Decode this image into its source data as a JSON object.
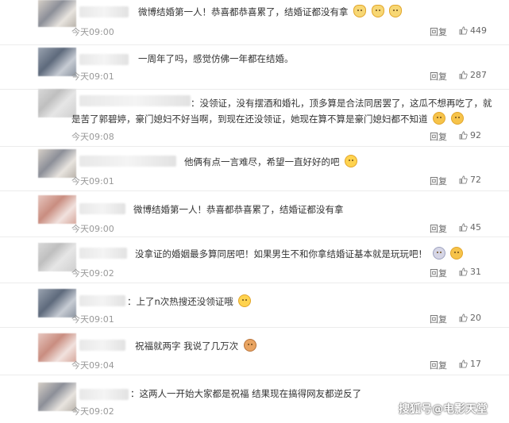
{
  "comments": [
    {
      "text": "微博结婚第一人！恭喜都恭喜累了，结婚证都没有拿",
      "time": "今天09:00",
      "reply": "回复",
      "likes": "449",
      "emojis": [
        "cat-icon",
        "cat-icon",
        "cat-icon"
      ]
    },
    {
      "text": "一周年了吗，感觉仿佛一年都在结婚。",
      "time": "今天09:01",
      "reply": "回复",
      "likes": "287",
      "emojis": []
    },
    {
      "text": "：没领证，没有摆酒和婚礼，顶多算是合法同居罢了，这瓜不想再吃了，就是苦了郭碧婷，豪门媳妇不好当啊，到现在还没领证，她现在算不算是豪门媳妇都不知道",
      "time": "今天09:08",
      "reply": "回复",
      "likes": "92",
      "emojis": [
        "sweat-icon",
        "sweat-icon"
      ]
    },
    {
      "text": "他俩有点一言难尽，希望一直好好的吧",
      "time": "今天09:01",
      "reply": "回复",
      "likes": "72",
      "emojis": [
        "laugh-cry-icon"
      ]
    },
    {
      "text": "微博结婚第一人！恭喜都恭喜累了，结婚证都没有拿",
      "time": "今天09:00",
      "reply": "回复",
      "likes": "45",
      "emojis": []
    },
    {
      "text": "没拿证的婚姻最多算同居吧！如果男生不和你拿结婚证基本就是玩玩吧！",
      "time": "今天09:02",
      "reply": "回复",
      "likes": "31",
      "emojis": [
        "shock-icon",
        "think-icon"
      ]
    },
    {
      "text": "：上了n次热搜还没领证哦",
      "time": "今天09:01",
      "reply": "回复",
      "likes": "20",
      "emojis": [
        "laugh-cry-icon"
      ]
    },
    {
      "text": "祝福就两字 我说了几万次",
      "time": "今天09:04",
      "reply": "回复",
      "likes": "17",
      "emojis": [
        "dog-icon"
      ]
    },
    {
      "text": "：这两人一开始大家都是祝福 结果现在搞得网友都逆反了",
      "time": "今天09:02",
      "reply": "",
      "likes": "",
      "emojis": []
    }
  ],
  "watermark": "搜狐号@电影天堂"
}
